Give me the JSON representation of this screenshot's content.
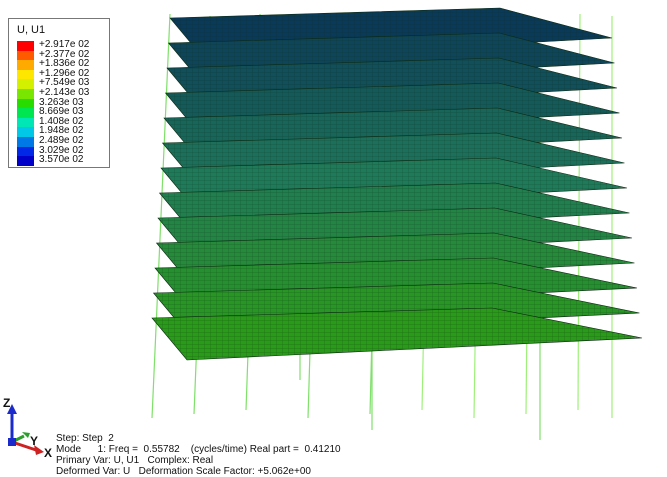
{
  "legend": {
    "title": "U, U1",
    "entries": [
      {
        "label": "+2.917e 02",
        "color": "#ff0000"
      },
      {
        "label": "+2.377e 02",
        "color": "#ff5a00"
      },
      {
        "label": "+1.836e 02",
        "color": "#ffaa00"
      },
      {
        "label": "+1.296e 02",
        "color": "#ffe600"
      },
      {
        "label": "+7.549e 03",
        "color": "#d2f000"
      },
      {
        "label": "+2.143e 03",
        "color": "#78e600"
      },
      {
        "label": "3.263e 03",
        "color": "#28dc00"
      },
      {
        "label": "8.669e 03",
        "color": "#00e650"
      },
      {
        "label": "1.408e 02",
        "color": "#00e6b4"
      },
      {
        "label": "1.948e 02",
        "color": "#00c8e6"
      },
      {
        "label": "2.489e 02",
        "color": "#0078e6"
      },
      {
        "label": "3.029e 02",
        "color": "#0028e6"
      },
      {
        "label": "3.570e 02",
        "color": "#0000c8"
      }
    ]
  },
  "triad": {
    "z": "Z",
    "y": "Y",
    "x": "X"
  },
  "info": {
    "line1": "Step: Step  2",
    "line2": "Mode      1: Freq =  0.55782    (cycles/time) Real part =  0.41210",
    "line3": "Primary Var: U, U1   Complex: Real",
    "line4": "Deformed Var: U   Deformation Scale Factor: +5.062e+00"
  },
  "model": {
    "floors": 13,
    "colors": {
      "top": "#0a3a5a",
      "mid": "#1f7a5a",
      "bottom": "#2a9a1a",
      "mesh": "#0b2a12",
      "column_left": "#7fe06a",
      "column_right": "#9ff07a",
      "background": "#ffffff"
    }
  }
}
